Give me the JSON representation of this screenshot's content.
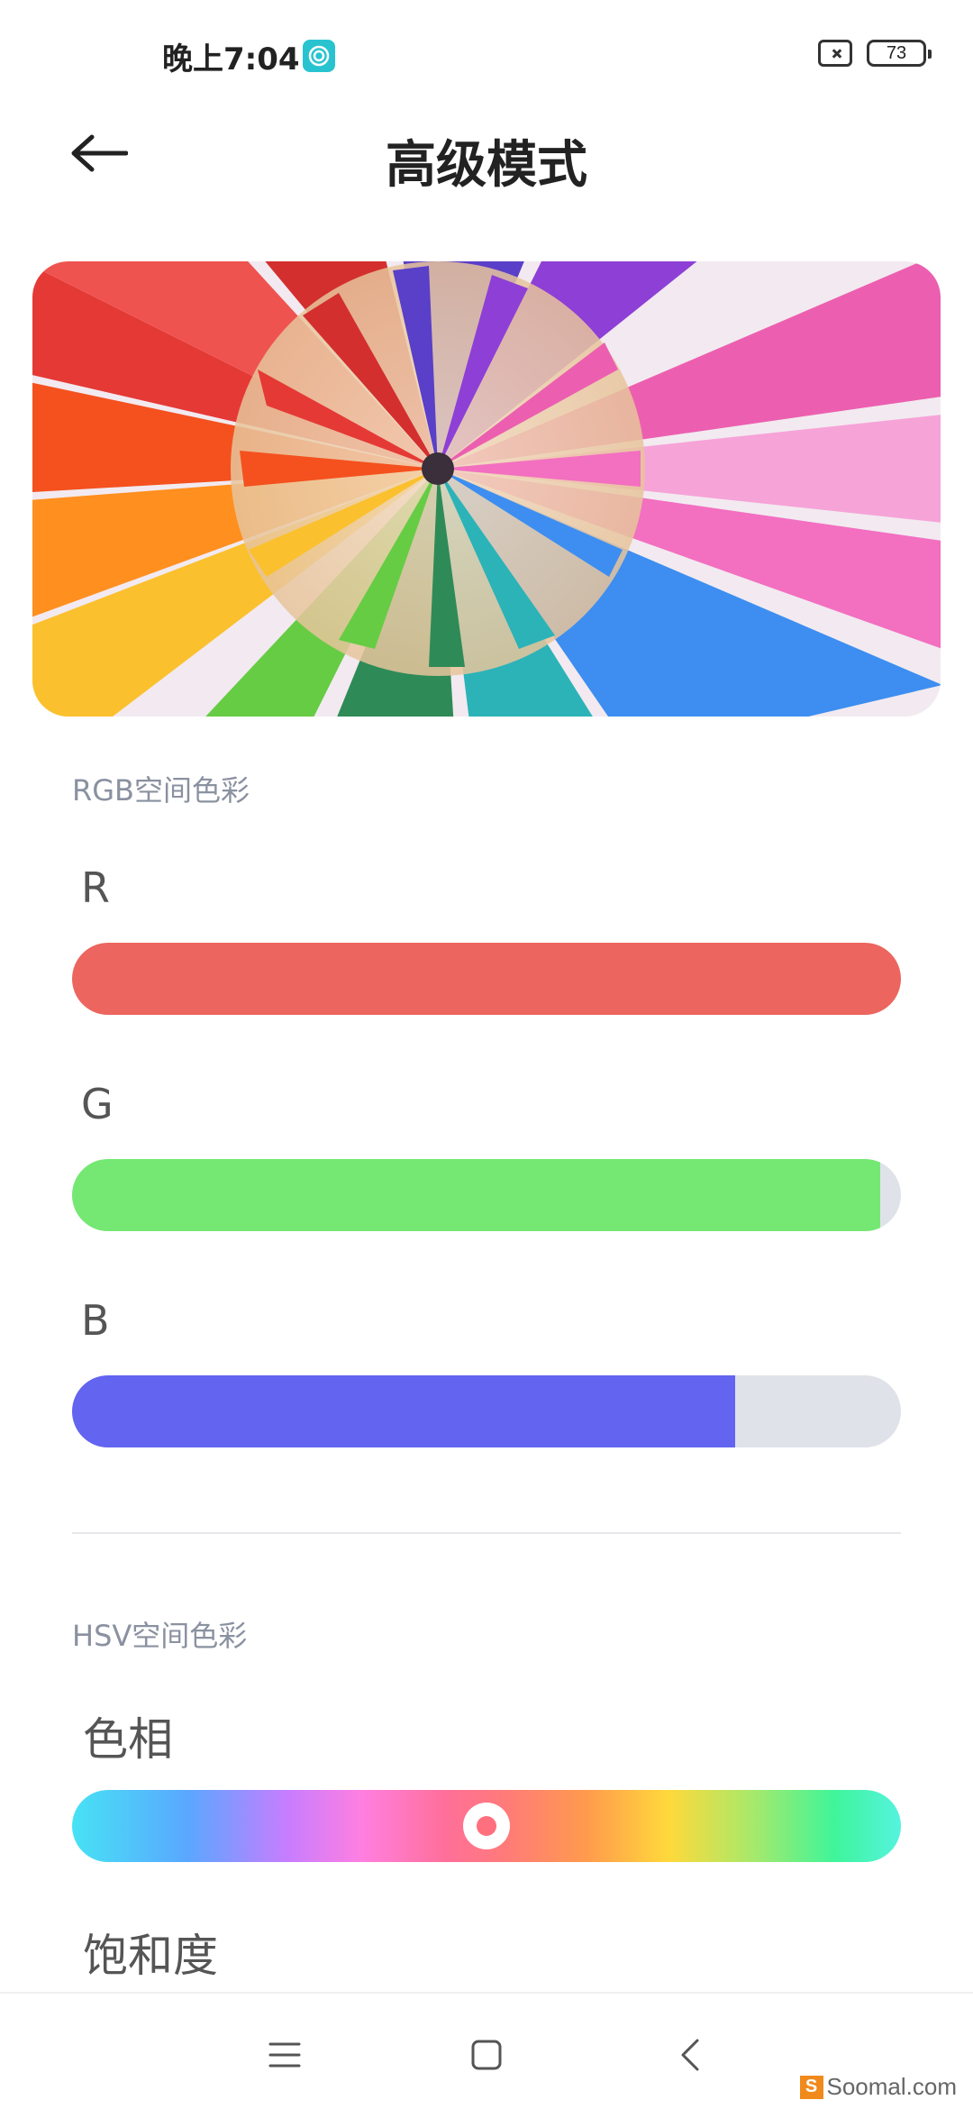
{
  "status_bar": {
    "time": "晚上7:04",
    "battery_level": "73"
  },
  "header": {
    "title": "高级模式"
  },
  "rgb_section": {
    "label": "RGB空间色彩",
    "channels": [
      {
        "label": "R",
        "color": "#ec655e",
        "fraction": 1.0
      },
      {
        "label": "G",
        "color": "#74e873",
        "fraction": 0.975
      },
      {
        "label": "B",
        "color": "#6364f0",
        "fraction": 0.8
      }
    ]
  },
  "hsv_section": {
    "label": "HSV空间色彩",
    "hue_label": "色相",
    "hue_fraction": 0.5,
    "saturation_label": "饱和度"
  },
  "nav_bar": {
    "icons": [
      "menu-icon",
      "home-icon",
      "back-icon"
    ]
  },
  "watermark": {
    "text": "Soomal.com",
    "badge": "S"
  },
  "colors": {
    "track_bg": "#dfe2e8",
    "section_label": "#8a91a0"
  }
}
